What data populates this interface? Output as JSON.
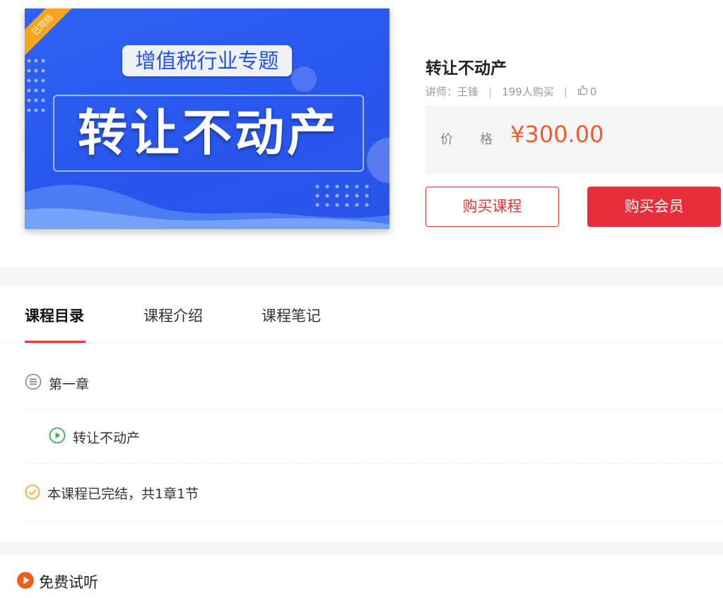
{
  "cover": {
    "badge": "已完结",
    "subtitle": "增值税行业专题",
    "title": "转让不动产"
  },
  "course": {
    "title": "转让不动产",
    "teacher": "讲师：王锋",
    "buyers": "199人购买",
    "likes": "0"
  },
  "price": {
    "label": "价格",
    "value": "¥300.00"
  },
  "buttons": {
    "buy_course": "购买课程",
    "buy_member": "购买会员"
  },
  "tabs": [
    "课程目录",
    "课程介绍",
    "课程笔记"
  ],
  "catalog": {
    "chapter": "第一章",
    "lesson": "转让不动产",
    "status": "本课程已完结，共1章1节"
  },
  "free_trial": "免费试听",
  "colors": {
    "accent": "#e33a3a",
    "price": "#f25c2a",
    "cover_blue": "#2856ee"
  }
}
